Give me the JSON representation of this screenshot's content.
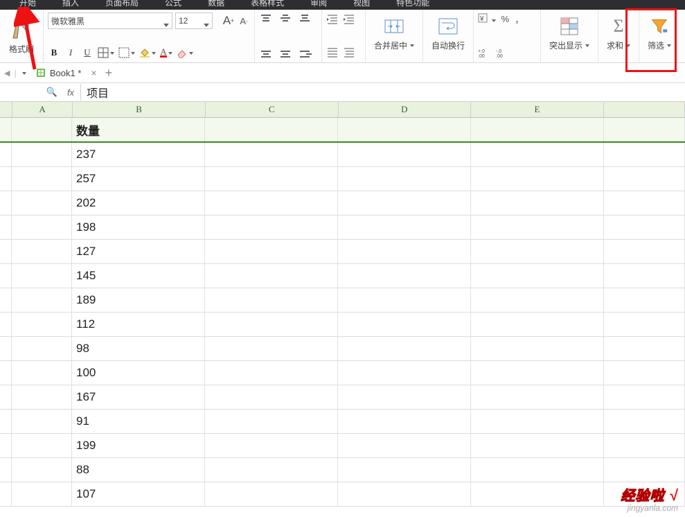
{
  "menubar": {
    "items": [
      "开始",
      "插入",
      "页面布局",
      "公式",
      "数据",
      "表格样式",
      "审阅",
      "视图",
      "特色功能"
    ]
  },
  "ribbon": {
    "font_name": "微软雅黑",
    "font_size": "12",
    "format_painter": "格式刷",
    "merge_center": "合并居中",
    "wrap_text": "自动换行",
    "highlight": "突出显示",
    "sum": "求和",
    "filter": "筛选",
    "aplus": "A",
    "aminus": "A",
    "percent": "%",
    "comma": "，",
    "cur": "￥",
    "dec_inc": ".00",
    "dec_dec": ".0"
  },
  "doc": {
    "name": "Book1 *"
  },
  "formula_bar": {
    "glass": "🔍",
    "fx": "fx",
    "value": "项目"
  },
  "columns": [
    "A",
    "B",
    "C",
    "D",
    "E"
  ],
  "sheet": {
    "header": "数量",
    "values": [
      "237",
      "257",
      "202",
      "198",
      "127",
      "145",
      "189",
      "112",
      "98",
      "100",
      "167",
      "91",
      "199",
      "88",
      "107"
    ]
  },
  "watermark": {
    "l1": "经验啦",
    "check": "√",
    "l2": "jingyanla.com"
  }
}
